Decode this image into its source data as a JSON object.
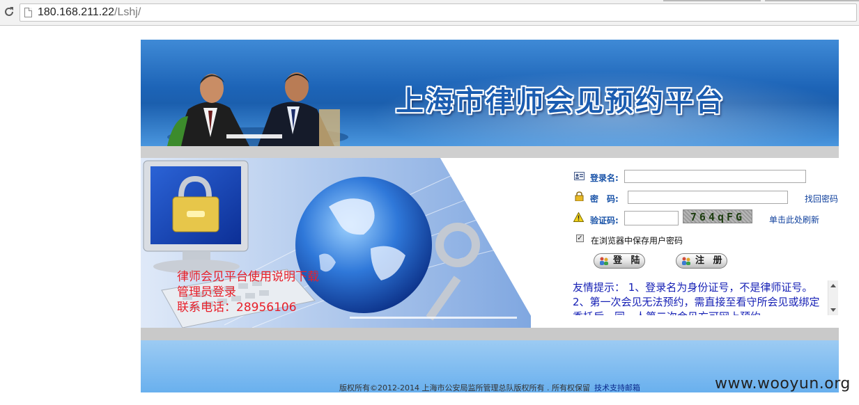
{
  "browser": {
    "url_host": "180.168.211.22",
    "url_path": "/Lshj/"
  },
  "banner": {
    "title": "上海市律师会见预约平台"
  },
  "links": {
    "manual_download": "律师会见平台使用说明下载",
    "admin_login": "管理员登录",
    "contact_phone": "联系电话：28956106"
  },
  "login": {
    "username_label": "登录名:",
    "username_value": "",
    "password_label": "密　码:",
    "password_value": "",
    "captcha_label": "验证码:",
    "captcha_value": "",
    "captcha_image_text": "764qFG",
    "forgot_password": "找回密码",
    "refresh_captcha": "单击此处刷新",
    "remember_label": "在浏览器中保存用户密码",
    "remember_checked": true,
    "login_button": "登 陆",
    "register_button": "注 册"
  },
  "tips": {
    "text": "友情提示： 1、登录名为身份证号，不是律师证号。 2、第一次会见无法预约，需直接至看守所会见或绑定委托后，同一人第二次会见方可网上预约。"
  },
  "footer": {
    "copyright": "版权所有©2012-2014 上海市公安局监所管理总队版权所有 . 所有权保留",
    "support_link": "技术支持邮箱"
  },
  "watermark": "www.wooyun.org",
  "colors": {
    "banner_blue": "#1d64b7",
    "label_blue": "#1953a8",
    "link_red": "#e8202a",
    "tips_blue": "#1620b5"
  },
  "icons": [
    "reload-icon",
    "page-icon",
    "user-card-icon",
    "lock-icon",
    "warning-icon",
    "login-users-icon",
    "register-users-icon"
  ]
}
